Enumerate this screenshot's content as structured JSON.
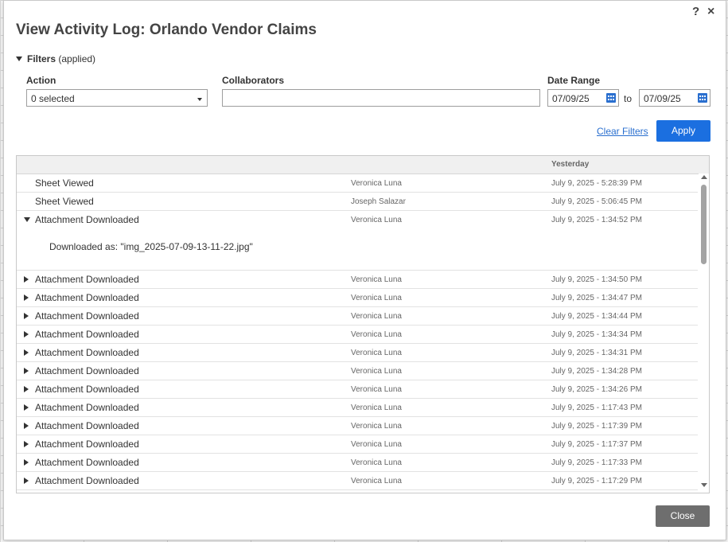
{
  "dialog": {
    "title": "View Activity Log: Orlando Vendor Claims",
    "help_label": "?",
    "close_label": "×"
  },
  "filters": {
    "label": "Filters",
    "state": "(applied)",
    "action_label": "Action",
    "action_value": "0 selected",
    "collaborators_label": "Collaborators",
    "collaborators_value": "",
    "date_range_label": "Date Range",
    "date_from": "07/09/25",
    "to_label": "to",
    "date_to": "07/09/25",
    "clear_label": "Clear Filters",
    "apply_label": "Apply"
  },
  "log": {
    "group_label": "Yesterday",
    "rows": [
      {
        "action": "Sheet Viewed",
        "user": "Veronica Luna",
        "time": "July 9, 2025 - 5:28:39 PM",
        "expandable": false
      },
      {
        "action": "Sheet Viewed",
        "user": "Joseph Salazar",
        "time": "July 9, 2025 - 5:06:45 PM",
        "expandable": false
      },
      {
        "action": "Attachment Downloaded",
        "user": "Veronica Luna",
        "time": "July 9, 2025 - 1:34:52 PM",
        "expandable": true,
        "expanded": true,
        "detail": "Downloaded as: \"img_2025-07-09-13-11-22.jpg\""
      },
      {
        "action": "Attachment Downloaded",
        "user": "Veronica Luna",
        "time": "July 9, 2025 - 1:34:50 PM",
        "expandable": true
      },
      {
        "action": "Attachment Downloaded",
        "user": "Veronica Luna",
        "time": "July 9, 2025 - 1:34:47 PM",
        "expandable": true
      },
      {
        "action": "Attachment Downloaded",
        "user": "Veronica Luna",
        "time": "July 9, 2025 - 1:34:44 PM",
        "expandable": true
      },
      {
        "action": "Attachment Downloaded",
        "user": "Veronica Luna",
        "time": "July 9, 2025 - 1:34:34 PM",
        "expandable": true
      },
      {
        "action": "Attachment Downloaded",
        "user": "Veronica Luna",
        "time": "July 9, 2025 - 1:34:31 PM",
        "expandable": true
      },
      {
        "action": "Attachment Downloaded",
        "user": "Veronica Luna",
        "time": "July 9, 2025 - 1:34:28 PM",
        "expandable": true
      },
      {
        "action": "Attachment Downloaded",
        "user": "Veronica Luna",
        "time": "July 9, 2025 - 1:34:26 PM",
        "expandable": true
      },
      {
        "action": "Attachment Downloaded",
        "user": "Veronica Luna",
        "time": "July 9, 2025 - 1:17:43 PM",
        "expandable": true
      },
      {
        "action": "Attachment Downloaded",
        "user": "Veronica Luna",
        "time": "July 9, 2025 - 1:17:39 PM",
        "expandable": true
      },
      {
        "action": "Attachment Downloaded",
        "user": "Veronica Luna",
        "time": "July 9, 2025 - 1:17:37 PM",
        "expandable": true
      },
      {
        "action": "Attachment Downloaded",
        "user": "Veronica Luna",
        "time": "July 9, 2025 - 1:17:33 PM",
        "expandable": true
      },
      {
        "action": "Attachment Downloaded",
        "user": "Veronica Luna",
        "time": "July 9, 2025 - 1:17:29 PM",
        "expandable": true
      }
    ]
  },
  "footer": {
    "close_label": "Close"
  },
  "colors": {
    "accent": "#1b6fe0",
    "close_button": "#6e6e6e",
    "link": "#2a6fcf"
  }
}
